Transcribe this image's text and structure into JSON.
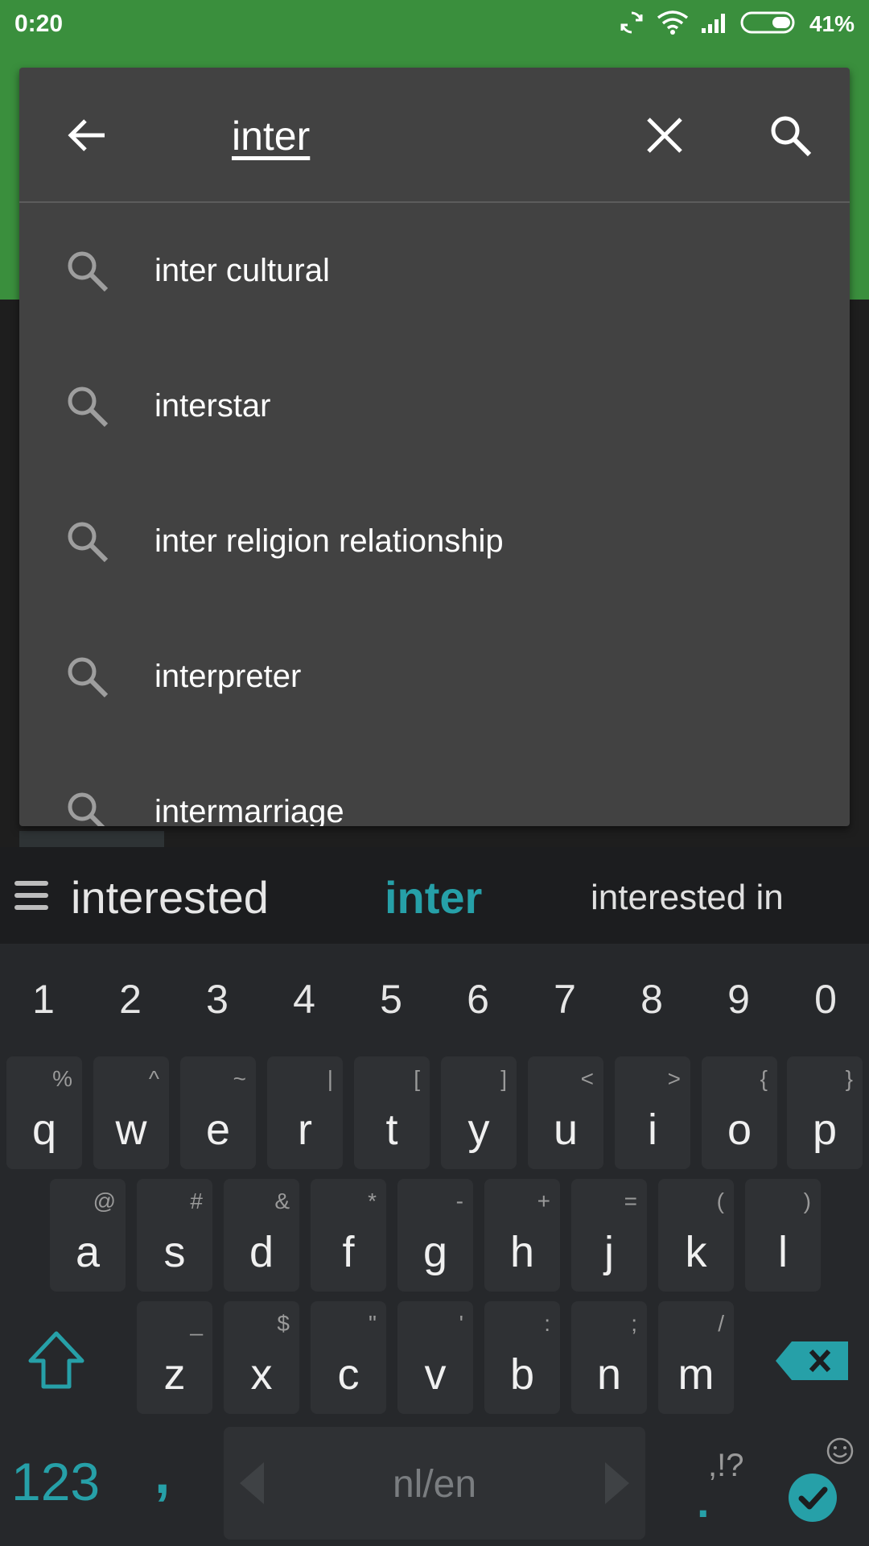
{
  "status_bar": {
    "time": "0:20",
    "battery_text": "41%"
  },
  "search": {
    "query": "inter",
    "suggestions": [
      "inter cultural",
      "interstar",
      "inter religion relationship",
      "interpreter",
      "intermarriage"
    ]
  },
  "suggestion_strip": {
    "left": "interested",
    "center": "inter",
    "right": "interested in"
  },
  "keyboard": {
    "numbers": [
      "1",
      "2",
      "3",
      "4",
      "5",
      "6",
      "7",
      "8",
      "9",
      "0"
    ],
    "row1": [
      {
        "main": "q",
        "alt": "%"
      },
      {
        "main": "w",
        "alt": "^"
      },
      {
        "main": "e",
        "alt": "~"
      },
      {
        "main": "r",
        "alt": "|"
      },
      {
        "main": "t",
        "alt": "["
      },
      {
        "main": "y",
        "alt": "]"
      },
      {
        "main": "u",
        "alt": "<"
      },
      {
        "main": "i",
        "alt": ">"
      },
      {
        "main": "o",
        "alt": "{"
      },
      {
        "main": "p",
        "alt": "}"
      }
    ],
    "row2": [
      {
        "main": "a",
        "alt": "@"
      },
      {
        "main": "s",
        "alt": "#"
      },
      {
        "main": "d",
        "alt": "&"
      },
      {
        "main": "f",
        "alt": "*"
      },
      {
        "main": "g",
        "alt": "-"
      },
      {
        "main": "h",
        "alt": "+"
      },
      {
        "main": "j",
        "alt": "="
      },
      {
        "main": "k",
        "alt": "("
      },
      {
        "main": "l",
        "alt": ")"
      }
    ],
    "row3": [
      {
        "main": "z",
        "alt": "_"
      },
      {
        "main": "x",
        "alt": "$"
      },
      {
        "main": "c",
        "alt": "\""
      },
      {
        "main": "v",
        "alt": "'"
      },
      {
        "main": "b",
        "alt": ":"
      },
      {
        "main": "n",
        "alt": ";"
      },
      {
        "main": "m",
        "alt": "/"
      }
    ],
    "symbols_label": "123",
    "comma_label": ",",
    "space_label": "nl/en",
    "punct_label": ",!?",
    "period_label": "."
  },
  "colors": {
    "status_green": "#3a8f3d",
    "accent_teal": "#26a0a8",
    "card_bg": "#424242"
  }
}
